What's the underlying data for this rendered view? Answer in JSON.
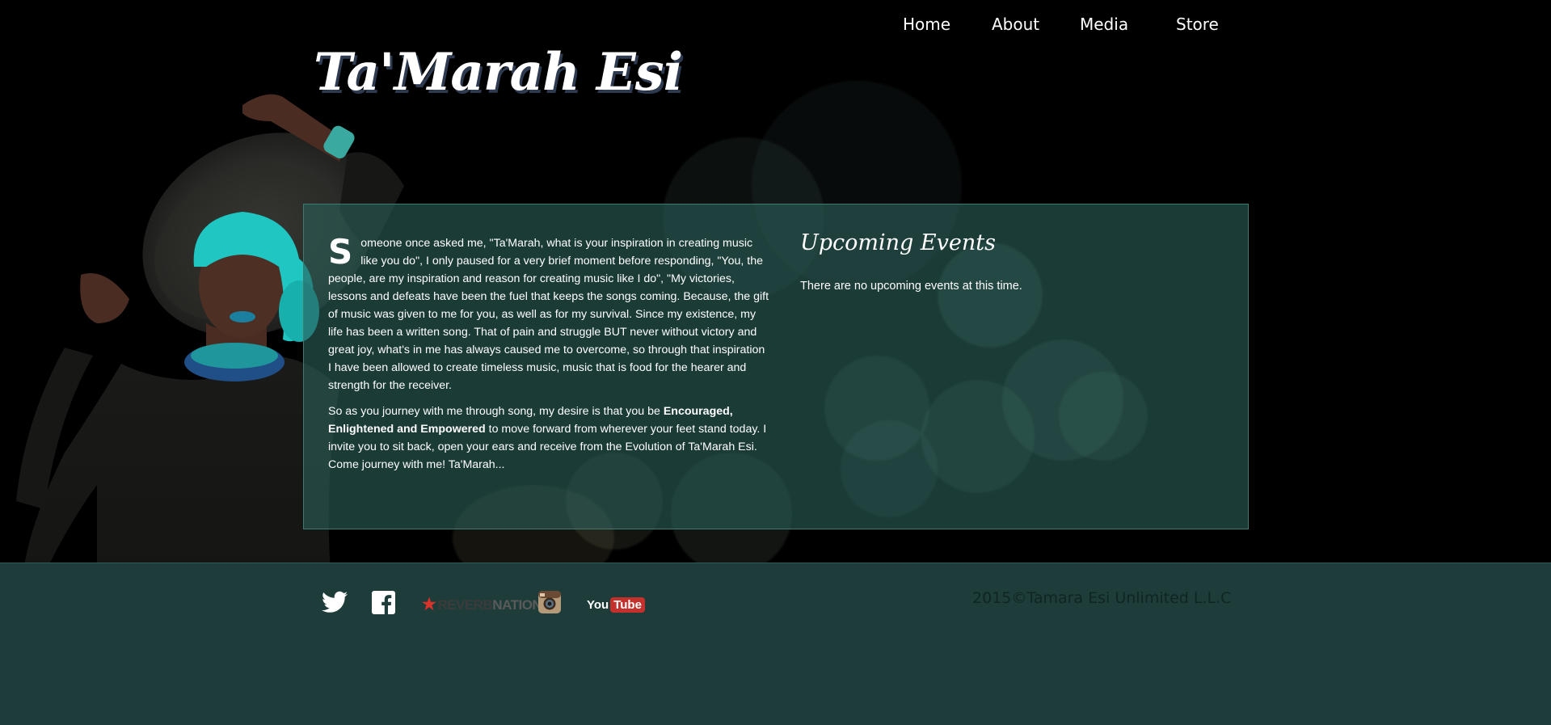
{
  "site": {
    "logo_text": "Ta'Marah Esi"
  },
  "nav": {
    "items": [
      {
        "label": "Home"
      },
      {
        "label": "About"
      },
      {
        "label": "Media"
      },
      {
        "label": "Store"
      }
    ]
  },
  "intro": {
    "dropcap": "S",
    "paragraph1_rest": "omeone once asked me, \"Ta'Marah, what is your inspiration in creating music like you do\", I only paused for a very brief moment before responding, \"You, the people, are my inspiration and reason for creating music like I do\", \"My victories, lessons and defeats have been the fuel that keeps the songs coming. Because, the gift of music was given to me for you, as well as for my survival. Since my existence, my life has been a written song. That of pain and struggle BUT never without victory and great joy, what's in me has always caused me to overcome, so through that inspiration I have been allowed to create timeless music, music that is food for the hearer and strength for the receiver.",
    "paragraph2_before": "So as you journey with me through song, my desire is that you be ",
    "paragraph2_bold": "Encouraged, Enlightened and Empowered",
    "paragraph2_after": " to move forward from wherever your feet stand today. I invite you to sit back, open your ears and receive from the Evolution of Ta'Marah Esi. Come journey with me! Ta'Marah..."
  },
  "events": {
    "title": "Upcoming Events",
    "empty_message": "There are no upcoming events at this time."
  },
  "footer": {
    "social": {
      "twitter_icon": "twitter-bird-icon",
      "facebook_icon": "facebook-f-icon",
      "reverbnation_star": "★",
      "reverbnation_reverb": "REVERB",
      "reverbnation_nation": "NATION",
      "instagram_icon": "instagram-camera-icon",
      "youtube_you": "You",
      "youtube_tube": "Tube"
    },
    "copyright": "2015©Tamara Esi Unlimited L.L.C"
  },
  "colors": {
    "background": "#000000",
    "panel": "#2c6058",
    "footer": "#1e3d3a",
    "accent_turquoise": "#1fc6c2",
    "youtube_red": "#c4302b",
    "reverbnation_red": "#d8322a"
  }
}
